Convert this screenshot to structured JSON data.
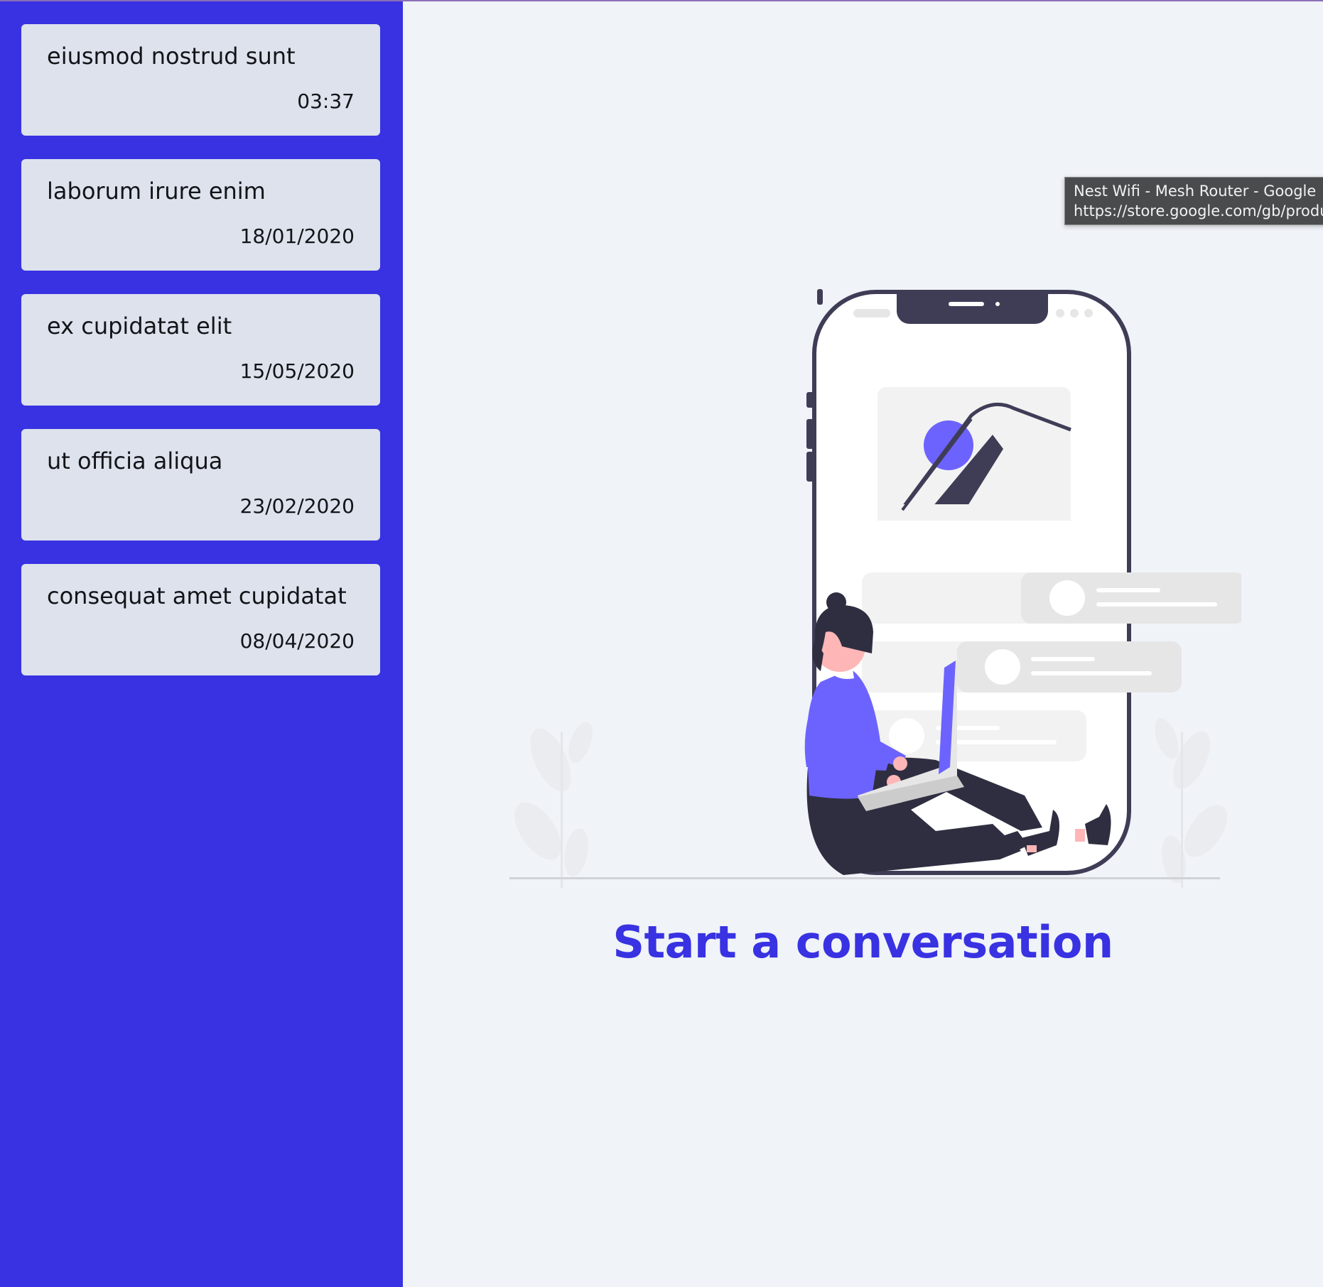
{
  "conversations": [
    {
      "title": "eiusmod nostrud sunt",
      "time": "03:37"
    },
    {
      "title": "laborum irure enim",
      "time": "18/01/2020"
    },
    {
      "title": "ex cupidatat elit",
      "time": "15/05/2020"
    },
    {
      "title": "ut officia aliqua",
      "time": "23/02/2020"
    },
    {
      "title": "consequat amet cupidatat",
      "time": "08/04/2020"
    }
  ],
  "main": {
    "cta": "Start a conversation"
  },
  "tooltip": {
    "line1": "Nest Wifi - Mesh Router - Google",
    "line2": "https://store.google.com/gb/produ"
  },
  "colors": {
    "sidebar": "#3832e2",
    "card": "#dde2ec",
    "background": "#f0f3f8",
    "accent": "#3832e2",
    "illustration_accent": "#6c63ff",
    "illustration_dark": "#3f3d56"
  },
  "icons": {
    "illustration": "person-with-laptop-and-phone-illustration"
  }
}
